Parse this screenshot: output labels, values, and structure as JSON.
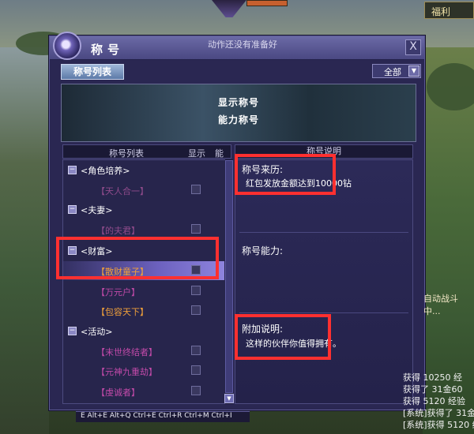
{
  "hud": {
    "top_right_label": "福利"
  },
  "window": {
    "title": "称号",
    "status_text": "动作还没有准备好",
    "close_label": "X"
  },
  "tab": {
    "label": "称号列表"
  },
  "filter": {
    "value": "全部"
  },
  "preview": {
    "line1": "显示称号",
    "line2": "能力称号"
  },
  "list": {
    "headers": {
      "name": "称号列表",
      "show": "显示",
      "ability": "能力"
    },
    "categories": [
      {
        "label": "<角色培养>",
        "items": [
          {
            "label": "【天人合一】",
            "color": "#c24aa9"
          }
        ]
      },
      {
        "label": "<夫妻>",
        "items": [
          {
            "label": "【的夫君】",
            "color": "#c24aa9"
          }
        ]
      },
      {
        "label": "<财富>",
        "items": [
          {
            "label": "【散财童子】",
            "color": "#f0a03a",
            "selected": true
          },
          {
            "label": "【万元户】",
            "color": "#c24aa9"
          },
          {
            "label": "【包容天下】",
            "color": "#f0a03a"
          }
        ]
      },
      {
        "label": "<活动>",
        "items": [
          {
            "label": "【末世终结者】",
            "color": "#c24aa9"
          },
          {
            "label": "【元神九重劫】",
            "color": "#c24aa9"
          },
          {
            "label": "【虔诚者】",
            "color": "#c24aa9"
          }
        ]
      }
    ]
  },
  "description": {
    "header": "称号说明",
    "source_title": "称号来历:",
    "source_body": "红包发放金额达到10000钻",
    "ability_title": "称号能力:",
    "extra_title": "附加说明:",
    "extra_body": "这样的伙伴你值得拥有。"
  },
  "overlay": {
    "battle_text": "自动战斗中...",
    "chat": [
      "获得 10250 经",
      "获得了 31金60",
      "获得 5120 经验",
      "[系统]获得了 31金60",
      "[系统]获得 5120 经"
    ],
    "skillbar": "E Alt+E Alt+Q Ctrl+E Ctrl+R Ctrl+M Ctrl+I"
  },
  "colors": {
    "highlight_box": "#ff3030",
    "window_bg": "#2a2752"
  }
}
